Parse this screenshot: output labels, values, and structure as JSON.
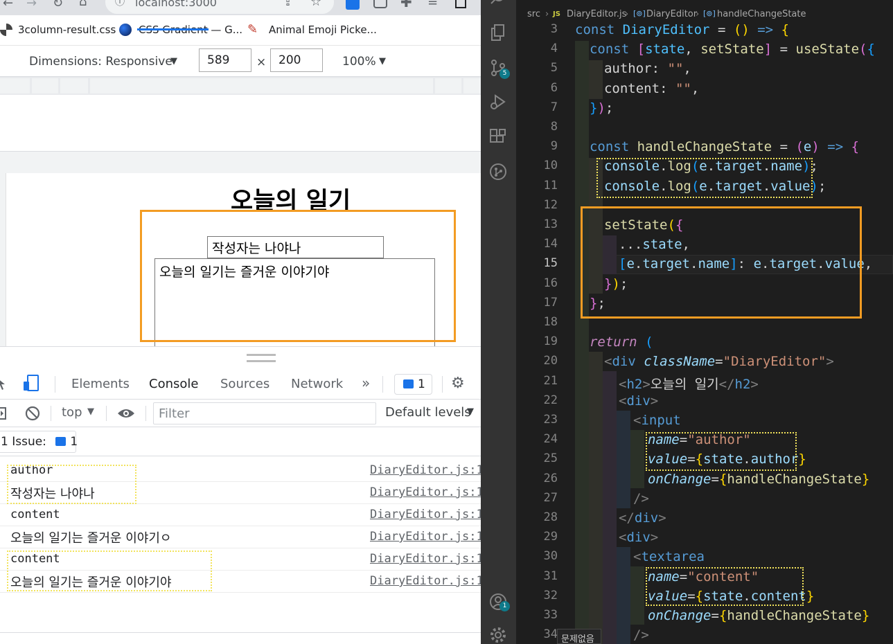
{
  "browser": {
    "url": "localhost:3000",
    "bookmarks": [
      "3column-result.css",
      "CSS Gradient — G...",
      "Animal Emoji Picke..."
    ],
    "device_toolbar": {
      "dimensions_label": "Dimensions: Responsive",
      "width": "589",
      "times": "×",
      "height": "200",
      "zoom": "100%"
    },
    "page": {
      "title": "오늘의 일기",
      "author_value": "작성자는 나야나",
      "content_value": "오늘의 일기는 즐거운 이야기야"
    }
  },
  "devtools": {
    "tabs": [
      "Elements",
      "Console",
      "Sources",
      "Network"
    ],
    "more": "»",
    "issues_count": "1",
    "context": "top",
    "filter_placeholder": "Filter",
    "levels": "Default levels",
    "issue_label": "1 Issue:",
    "issue_badge": "1",
    "logs": [
      {
        "message": "author",
        "source": "DiaryEditor.js:1"
      },
      {
        "message": "작성자는 나야나",
        "source": "DiaryEditor.js:1"
      },
      {
        "message": "content",
        "source": "DiaryEditor.js:1"
      },
      {
        "message": "오늘의 일기는 즐거운 이야기ㅇ",
        "source": "DiaryEditor.js:1"
      },
      {
        "message": "content",
        "source": "DiaryEditor.js:1"
      },
      {
        "message": "오늘의 일기는 즐거운 이야기야",
        "source": "DiaryEditor.js:1"
      }
    ]
  },
  "editor": {
    "breadcrumb": [
      "src",
      "JS",
      "DiaryEditor.js",
      "DiaryEditor",
      "handleChangeState"
    ],
    "line_numbers": [
      "3",
      "4",
      "5",
      "6",
      "7",
      "8",
      "9",
      "10",
      "11",
      "12",
      "13",
      "14",
      "15",
      "16",
      "17",
      "18",
      "19",
      "20",
      "21",
      "22",
      "23",
      "24",
      "25",
      "26",
      "27",
      "28",
      "29",
      "30",
      "31",
      "32",
      "33",
      "34"
    ],
    "current_line": "15",
    "source_badge": "5",
    "account_badge": "1",
    "tooltip": "문제없음",
    "code": {
      "l3": [
        "const",
        " ",
        "DiaryEditor",
        " ",
        "=",
        " ",
        "(",
        ")",
        " ",
        "=>",
        " ",
        "{"
      ],
      "l4": [
        "const",
        " ",
        "[",
        "state",
        ",",
        " ",
        "setState",
        "]",
        " ",
        "=",
        " ",
        "useState",
        "(",
        "{"
      ],
      "l5": [
        "author",
        ":",
        " ",
        "\"\"",
        ","
      ],
      "l6": [
        "content",
        ":",
        " ",
        "\"\"",
        ","
      ],
      "l7": [
        "}",
        ")",
        ";"
      ],
      "l9": [
        "const",
        " ",
        "handleChangeState",
        " ",
        "=",
        " ",
        "(",
        "e",
        ")",
        " ",
        "=>",
        " ",
        "{"
      ],
      "l10": [
        "console",
        ".",
        "log",
        "(",
        "e",
        ".",
        "target",
        ".",
        "name",
        ")",
        ";"
      ],
      "l11": [
        "console",
        ".",
        "log",
        "(",
        "e",
        ".",
        "target",
        ".",
        "value",
        ")",
        ";"
      ],
      "l13": [
        "setState",
        "(",
        "{"
      ],
      "l14": [
        "...",
        "state",
        ","
      ],
      "l15": [
        "[",
        "e",
        ".",
        "target",
        ".",
        "name",
        "]",
        ":",
        " ",
        "e",
        ".",
        "target",
        ".",
        "value",
        ","
      ],
      "l16": [
        "}",
        ")",
        ";"
      ],
      "l17": [
        "}",
        ";"
      ],
      "l19": [
        "return",
        " ",
        "("
      ],
      "l20": [
        "<",
        "div",
        " ",
        "className",
        "=",
        "\"DiaryEditor\"",
        ">"
      ],
      "l21": [
        "<",
        "h2",
        ">",
        "오늘의 일기",
        "</",
        "h2",
        ">"
      ],
      "l22": [
        "<",
        "div",
        ">"
      ],
      "l23": [
        "<",
        "input"
      ],
      "l24": [
        "name",
        "=",
        "\"author\""
      ],
      "l25": [
        "value",
        "=",
        "{",
        "state",
        ".",
        "author",
        "}"
      ],
      "l26": [
        "onChange",
        "=",
        "{",
        "handleChangeState",
        "}"
      ],
      "l27": [
        "/>"
      ],
      "l28": [
        "</",
        "div",
        ">"
      ],
      "l29": [
        "<",
        "div",
        ">"
      ],
      "l30": [
        "<",
        "textarea"
      ],
      "l31": [
        "name",
        "=",
        "\"content\""
      ],
      "l32": [
        "value",
        "=",
        "{",
        "state",
        ".",
        "content",
        "}"
      ],
      "l33": [
        "onChange",
        "=",
        "{",
        "handleChangeState",
        "}"
      ],
      "l34": [
        "/>"
      ]
    }
  },
  "colors": {
    "highlight_orange": "#f39c23",
    "dotted_yellow": "#f2e35c",
    "editor_bg": "#1e1e1e",
    "devtools_active_tab": "#1a73e8"
  }
}
